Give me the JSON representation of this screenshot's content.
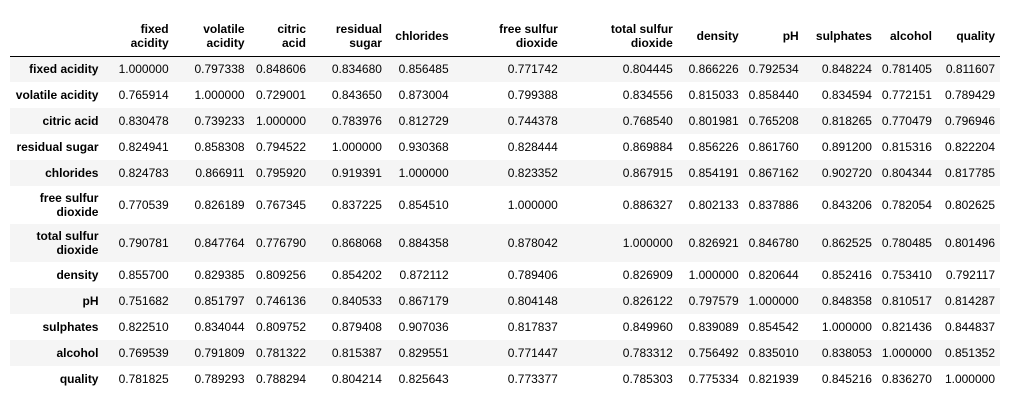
{
  "table": {
    "columns": [
      "fixed\nacidity",
      "volatile\nacidity",
      "citric\nacid",
      "residual\nsugar",
      "chlorides",
      "free sulfur\ndioxide",
      "total sulfur\ndioxide",
      "density",
      "pH",
      "sulphates",
      "alcohol",
      "quality"
    ],
    "rows": [
      {
        "label": "fixed acidity",
        "values": [
          "1.000000",
          "0.797338",
          "0.848606",
          "0.834680",
          "0.856485",
          "0.771742",
          "0.804445",
          "0.866226",
          "0.792534",
          "0.848224",
          "0.781405",
          "0.811607"
        ]
      },
      {
        "label": "volatile acidity",
        "values": [
          "0.765914",
          "1.000000",
          "0.729001",
          "0.843650",
          "0.873004",
          "0.799388",
          "0.834556",
          "0.815033",
          "0.858440",
          "0.834594",
          "0.772151",
          "0.789429"
        ]
      },
      {
        "label": "citric acid",
        "values": [
          "0.830478",
          "0.739233",
          "1.000000",
          "0.783976",
          "0.812729",
          "0.744378",
          "0.768540",
          "0.801981",
          "0.765208",
          "0.818265",
          "0.770479",
          "0.796946"
        ]
      },
      {
        "label": "residual sugar",
        "values": [
          "0.824941",
          "0.858308",
          "0.794522",
          "1.000000",
          "0.930368",
          "0.828444",
          "0.869884",
          "0.856226",
          "0.861760",
          "0.891200",
          "0.815316",
          "0.822204"
        ]
      },
      {
        "label": "chlorides",
        "values": [
          "0.824783",
          "0.866911",
          "0.795920",
          "0.919391",
          "1.000000",
          "0.823352",
          "0.867915",
          "0.854191",
          "0.867162",
          "0.902720",
          "0.804344",
          "0.817785"
        ]
      },
      {
        "label": "free sulfur\ndioxide",
        "values": [
          "0.770539",
          "0.826189",
          "0.767345",
          "0.837225",
          "0.854510",
          "1.000000",
          "0.886327",
          "0.802133",
          "0.837886",
          "0.843206",
          "0.782054",
          "0.802625"
        ]
      },
      {
        "label": "total sulfur\ndioxide",
        "values": [
          "0.790781",
          "0.847764",
          "0.776790",
          "0.868068",
          "0.884358",
          "0.878042",
          "1.000000",
          "0.826921",
          "0.846780",
          "0.862525",
          "0.780485",
          "0.801496"
        ]
      },
      {
        "label": "density",
        "values": [
          "0.855700",
          "0.829385",
          "0.809256",
          "0.854202",
          "0.872112",
          "0.789406",
          "0.826909",
          "1.000000",
          "0.820644",
          "0.852416",
          "0.753410",
          "0.792117"
        ]
      },
      {
        "label": "pH",
        "values": [
          "0.751682",
          "0.851797",
          "0.746136",
          "0.840533",
          "0.867179",
          "0.804148",
          "0.826122",
          "0.797579",
          "1.000000",
          "0.848358",
          "0.810517",
          "0.814287"
        ]
      },
      {
        "label": "sulphates",
        "values": [
          "0.822510",
          "0.834044",
          "0.809752",
          "0.879408",
          "0.907036",
          "0.817837",
          "0.849960",
          "0.839089",
          "0.854542",
          "1.000000",
          "0.821436",
          "0.844837"
        ]
      },
      {
        "label": "alcohol",
        "values": [
          "0.769539",
          "0.791809",
          "0.781322",
          "0.815387",
          "0.829551",
          "0.771447",
          "0.783312",
          "0.756492",
          "0.835010",
          "0.838053",
          "1.000000",
          "0.851352"
        ]
      },
      {
        "label": "quality",
        "values": [
          "0.781825",
          "0.789293",
          "0.788294",
          "0.804214",
          "0.825643",
          "0.773377",
          "0.785303",
          "0.775334",
          "0.821939",
          "0.845216",
          "0.836270",
          "1.000000"
        ]
      }
    ]
  }
}
